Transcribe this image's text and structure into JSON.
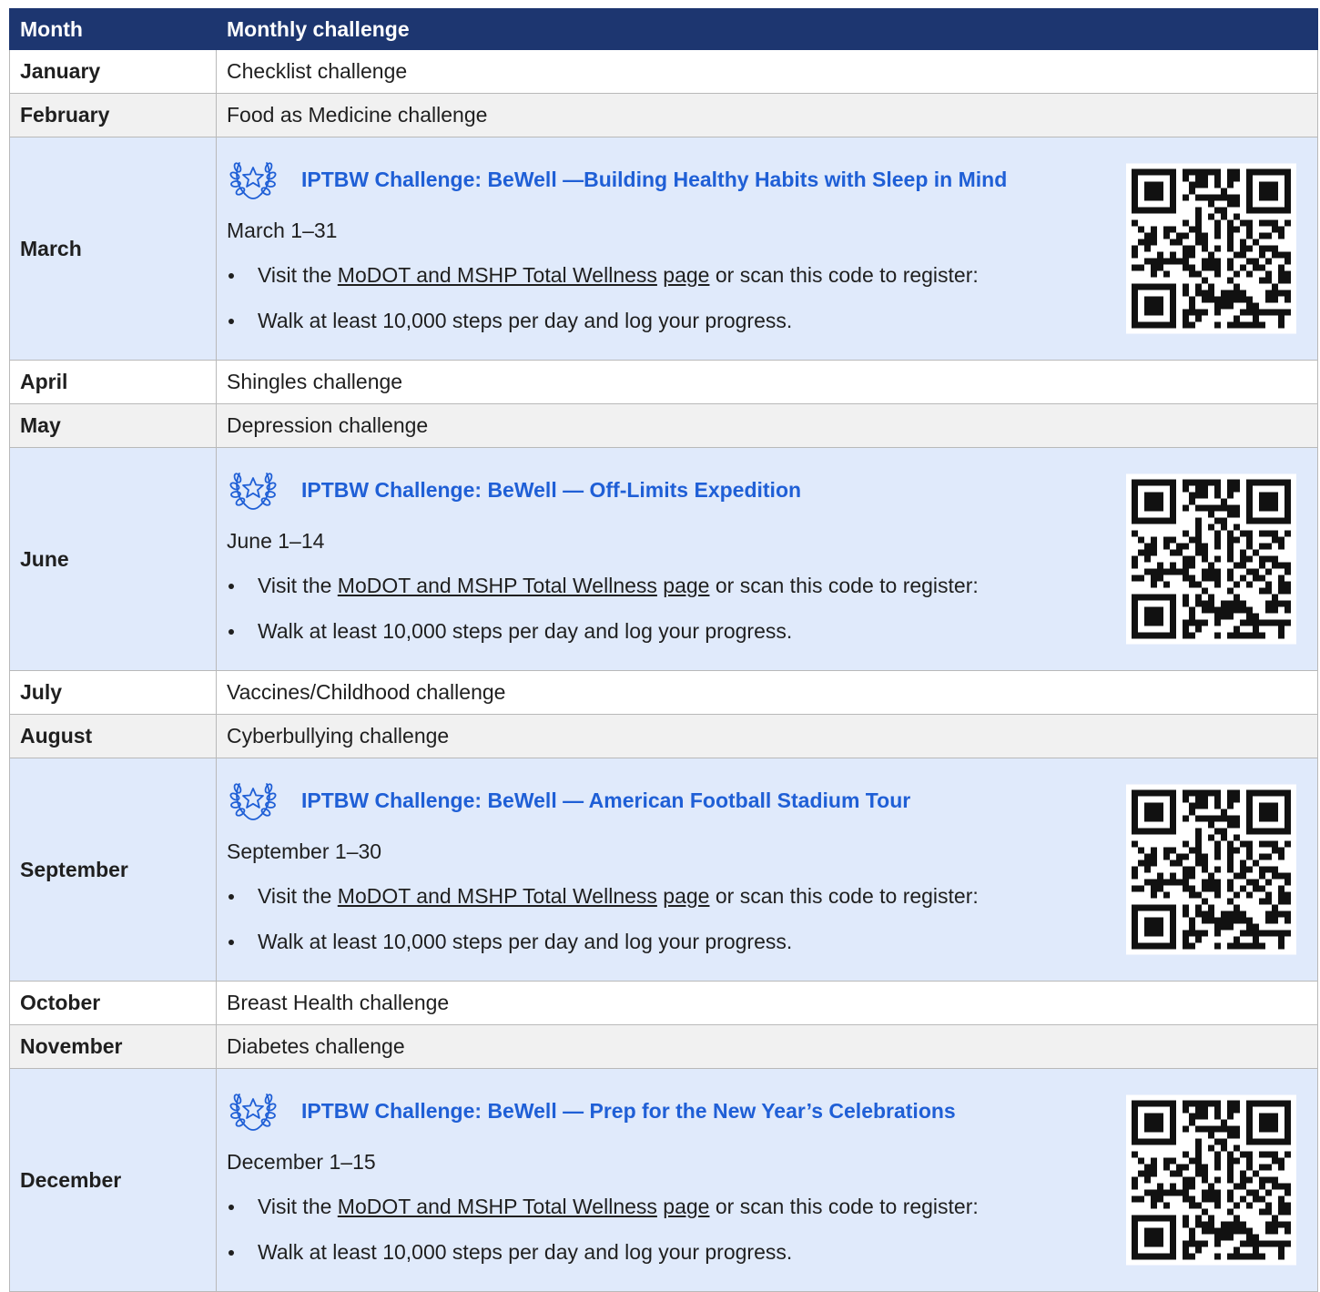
{
  "header": {
    "month": "Month",
    "challenge": "Monthly challenge"
  },
  "rows": [
    {
      "month": "January",
      "challenge": "Checklist challenge"
    },
    {
      "month": "February",
      "challenge": "Food as Medicine challenge"
    },
    {
      "month": "March",
      "title": "IPTBW Challenge: BeWell —Building Healthy Habits with Sleep in Mind",
      "dates": "March 1–31"
    },
    {
      "month": "April",
      "challenge": "Shingles challenge"
    },
    {
      "month": "May",
      "challenge": "Depression challenge"
    },
    {
      "month": "June",
      "title": "IPTBW Challenge: BeWell — Off-Limits Expedition",
      "dates": "June 1–14"
    },
    {
      "month": "July",
      "challenge": "Vaccines/Childhood challenge"
    },
    {
      "month": "August",
      "challenge": "Cyberbullying challenge"
    },
    {
      "month": "September",
      "title": "IPTBW Challenge: BeWell — American Football Stadium Tour",
      "dates": "September 1–30"
    },
    {
      "month": "October",
      "challenge": "Breast Health challenge"
    },
    {
      "month": "November",
      "challenge": "Diabetes challenge"
    },
    {
      "month": "December",
      "title": "IPTBW Challenge: BeWell —  Prep for the New Year’s Celebrations",
      "dates": "December 1–15"
    }
  ],
  "feature_common": {
    "visit_prefix": "Visit the ",
    "link_text": "MoDOT and MSHP Total Wellness",
    "page_text": "page",
    "visit_suffix": " or scan this code to register:",
    "walk_text": "Walk at least 10,000 steps per day and log your progress."
  },
  "colors": {
    "header_bg": "#1d3670",
    "feature_bg": "#e0eafb",
    "title_blue": "#1f5fd6",
    "alt_row_bg": "#f1f1f1"
  },
  "icons": {
    "badge": "laurel-star-icon",
    "qr": "qr-code-icon"
  }
}
